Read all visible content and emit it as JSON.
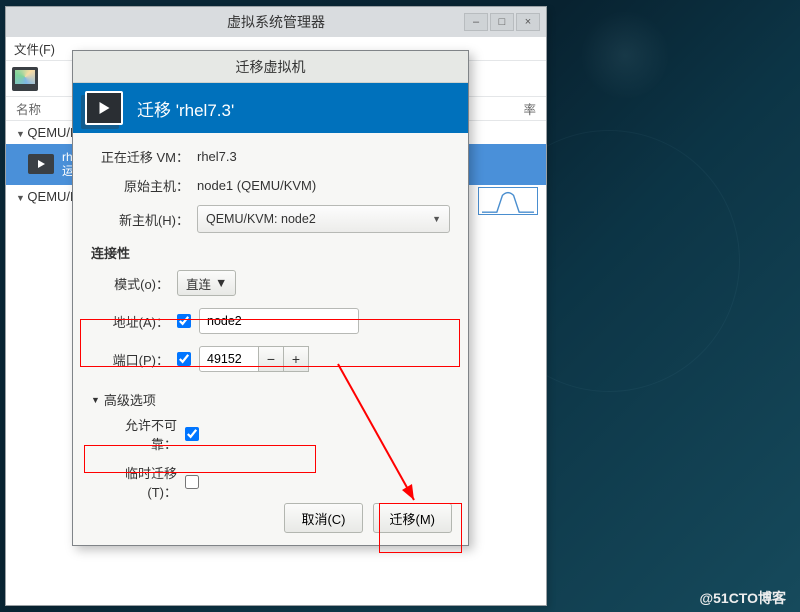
{
  "parent_window": {
    "title": "虚拟系统管理器",
    "menu": {
      "file": "文件(F)"
    },
    "columns": {
      "name": "名称",
      "rate": "率"
    },
    "hosts": [
      {
        "label": "QEMU/K..."
      },
      {
        "label": "QEMU/K..."
      }
    ],
    "selected_vm": {
      "name": "rh",
      "status": "运"
    }
  },
  "dialog": {
    "title": "迁移虚拟机",
    "header": "迁移 'rhel7.3'",
    "labels": {
      "migrating_vm": "正在迁移 VM：",
      "orig_host": "原始主机：",
      "new_host": "新主机(H)：",
      "connectivity": "连接性",
      "mode": "模式(o)：",
      "address": "地址(A)：",
      "port": "端口(P)：",
      "advanced": "高级选项",
      "allow_unsafe": "允许不可靠：",
      "temporary": "临时迁移(T)："
    },
    "values": {
      "vm_name": "rhel7.3",
      "orig_host": "node1 (QEMU/KVM)",
      "new_host": "QEMU/KVM: node2",
      "mode": "直连",
      "address_checked": true,
      "address": "node2",
      "port_checked": true,
      "port": "49152",
      "allow_unsafe_checked": true,
      "temporary_checked": false
    },
    "buttons": {
      "cancel": "取消(C)",
      "migrate": "迁移(M)"
    }
  },
  "watermark": "@51CTO博客"
}
